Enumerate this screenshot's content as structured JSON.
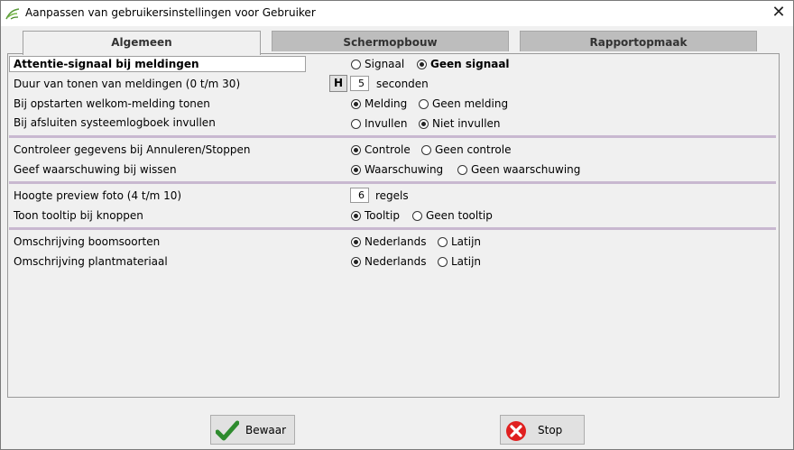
{
  "window": {
    "title": "Aanpassen van gebruikersinstellingen voor Gebruiker"
  },
  "tabs": [
    {
      "label": "Algemeen"
    },
    {
      "label": "Schermopbouw"
    },
    {
      "label": "Rapportopmaak"
    }
  ],
  "settings": {
    "attentie": {
      "label": "Attentie-signaal bij meldingen",
      "opt1": "Signaal",
      "opt2": "Geen signaal"
    },
    "duur": {
      "label": "Duur van tonen van meldingen (0 t/m 30)",
      "button": "H",
      "value": "5",
      "unit": "seconden"
    },
    "welkom": {
      "label": "Bij opstarten welkom-melding tonen",
      "opt1": "Melding",
      "opt2": "Geen melding"
    },
    "logboek": {
      "label": "Bij afsluiten systeemlogboek invullen",
      "opt1": "Invullen",
      "opt2": "Niet invullen"
    },
    "controle": {
      "label": "Controleer gegevens bij Annuleren/Stoppen",
      "opt1": "Controle",
      "opt2": "Geen controle"
    },
    "wissen": {
      "label": "Geef waarschuwing bij wissen",
      "opt1": "Waarschuwing",
      "opt2": "Geen waarschuwing"
    },
    "preview": {
      "label": "Hoogte preview foto (4 t/m 10)",
      "value": "6",
      "unit": "regels"
    },
    "tooltip": {
      "label": "Toon tooltip bij knoppen",
      "opt1": "Tooltip",
      "opt2": "Geen tooltip"
    },
    "boomsoorten": {
      "label": "Omschrijving boomsoorten",
      "opt1": "Nederlands",
      "opt2": "Latijn"
    },
    "plantmateriaal": {
      "label": "Omschrijving plantmateriaal",
      "opt1": "Nederlands",
      "opt2": "Latijn"
    }
  },
  "buttons": {
    "save": "Bewaar",
    "stop": "Stop"
  },
  "icons": {
    "app": "leaf-icon",
    "save": "checkmark-icon",
    "stop": "stop-x-icon",
    "close": "close-icon"
  }
}
